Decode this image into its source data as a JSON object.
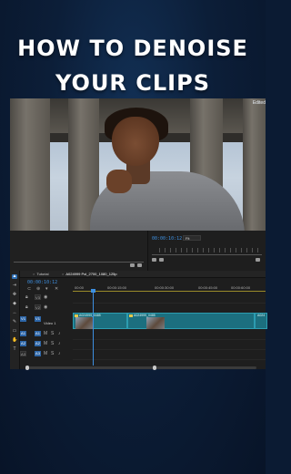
{
  "title": {
    "line1": "HOW TO DENOISE",
    "line2": "YOUR CLIPS"
  },
  "preview": {
    "edge_label": "Edited"
  },
  "source_monitor": {
    "timecode": "00:00:10:12",
    "zoom": "Fit"
  },
  "timeline": {
    "tabs": [
      {
        "label": "Tutorial"
      },
      {
        "label": "A024999 Pol_2700_1080_125p"
      }
    ],
    "timecode": "00:00:10:12",
    "ruler": [
      "00:00",
      "00:00:15:00",
      "00:00:30:00",
      "00:00:45:00",
      "00:00:60:00",
      "00:00:75:00"
    ],
    "tracks": {
      "video": [
        {
          "label": "V3",
          "name": ""
        },
        {
          "label": "V2",
          "name": ""
        },
        {
          "label": "V1",
          "name": "Video 1"
        }
      ],
      "audio": [
        {
          "label": "A1"
        },
        {
          "label": "A2"
        },
        {
          "label": "A3"
        }
      ]
    },
    "clips": [
      {
        "name": "A024999_0485"
      },
      {
        "name": "A024999_0485"
      },
      {
        "name": "A024"
      }
    ]
  },
  "icon_names": [
    "selection-tool-icon",
    "track-select-icon",
    "ripple-edit-icon",
    "razor-icon",
    "slip-icon",
    "pen-icon",
    "hand-icon",
    "type-icon"
  ]
}
